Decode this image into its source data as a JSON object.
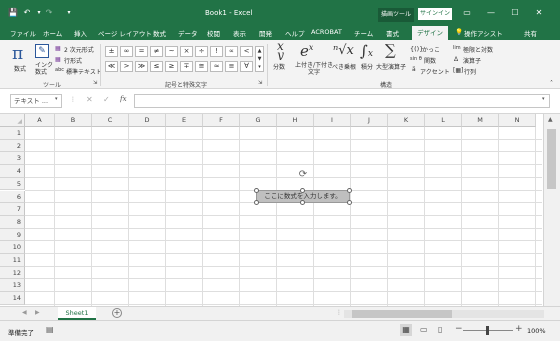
{
  "title": {
    "text": "Book1 - Excel",
    "context_tool": "描画ツール",
    "signin": "サインイン"
  },
  "tabs": [
    "ファイル",
    "ホーム",
    "挿入",
    "ページ レイアウト",
    "数式",
    "データ",
    "校閲",
    "表示",
    "開発",
    "ヘルプ",
    "ACROBAT",
    "チーム",
    "書式",
    "デザイン"
  ],
  "tell_me": "操作アシスト",
  "share": "共有",
  "ribbon": {
    "tools": {
      "equation": "数式",
      "ink": "インク数式",
      "linear2d": "2 次元形式",
      "linear": "行形式",
      "normal_text": "標準テキスト",
      "group": "ツール"
    },
    "symbols": {
      "items": [
        "±",
        "∞",
        "=",
        "≠",
        "~",
        "×",
        "÷",
        "!",
        "∝",
        "<",
        "≪",
        ">",
        "≫",
        "≤",
        "≥",
        "∓",
        "≅",
        "≈",
        "≡",
        "∀"
      ],
      "group": "記号と特殊文字"
    },
    "structures": {
      "fraction": "分数",
      "script": "上付き/下付き\n文字",
      "radical": "べき乗根",
      "integral": "積分",
      "large_op": "大型演算子",
      "bracket": "かっこ",
      "function": "関数",
      "accent": "アクセント",
      "limit": "極限と対数",
      "operator": "演算子",
      "matrix": "行列",
      "group": "構造"
    }
  },
  "formula_bar": {
    "name_box": "テキスト ...",
    "fx": "fx"
  },
  "columns": [
    "A",
    "B",
    "C",
    "D",
    "E",
    "F",
    "G",
    "H",
    "I",
    "J",
    "K",
    "L",
    "M",
    "N"
  ],
  "rows": [
    "1",
    "2",
    "3",
    "4",
    "5",
    "6",
    "7",
    "8",
    "9",
    "10",
    "11",
    "12",
    "13",
    "14"
  ],
  "equation_box": {
    "text": "ここに数式を入力します。"
  },
  "sheet": {
    "tab": "Sheet1"
  },
  "status": {
    "ready": "準備完了",
    "zoom": "100%"
  }
}
